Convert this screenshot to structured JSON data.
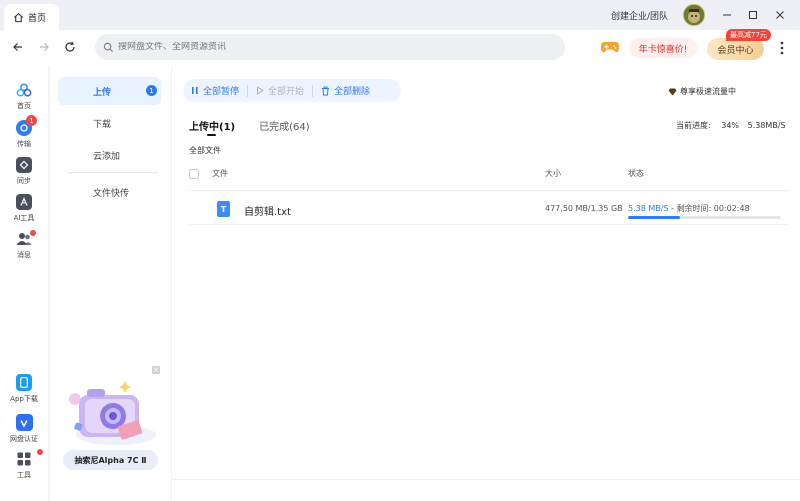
{
  "window": {
    "tab_label": "首页",
    "enterprise_label": "创建企业/团队"
  },
  "search": {
    "placeholder": "搜网盘文件、全网资源资讯"
  },
  "header": {
    "promo_label": "年卡惊喜价!",
    "vip_label": "会员中心",
    "vip_badge": "最高减77元"
  },
  "rail": {
    "items": [
      {
        "label": "首页"
      },
      {
        "label": "传输",
        "badge": "1"
      },
      {
        "label": "同步"
      },
      {
        "label": "AI工具"
      },
      {
        "label": "消息"
      },
      {
        "label": "App下载"
      },
      {
        "label": "网盘认证"
      },
      {
        "label": "工具"
      }
    ]
  },
  "subnav": {
    "items": [
      {
        "label": "上传",
        "badge": "1"
      },
      {
        "label": "下载"
      },
      {
        "label": "云添加"
      },
      {
        "label": "文件快传"
      }
    ],
    "ad_label": "抽索尼Alpha 7C Ⅱ",
    "ad_close": "×"
  },
  "toolbar": {
    "pause_all": "全部暂停",
    "start_all": "全部开始",
    "delete_all": "全部删除",
    "speedup": "尊享极速流量中"
  },
  "tabs": {
    "uploading": "上传中(1)",
    "completed": "已完成(64)"
  },
  "progress": {
    "label": "当前进度:",
    "percent": "34%",
    "speed": "5.38MB/S"
  },
  "list": {
    "filter_label": "全部文件",
    "headers": {
      "file": "文件",
      "size": "大小",
      "status": "状态"
    },
    "rows": [
      {
        "icon": "T",
        "name": "自剪辑.txt",
        "size": "477.50 MB/1.35 GB",
        "speed": "5.38 MB/S",
        "remaining": " - 剩余时间: 00:02:48",
        "progress": 0.34
      }
    ]
  },
  "colors": {
    "accent": "#2f7bf2",
    "badge": "#f04848",
    "vip": "#f4cf93"
  }
}
